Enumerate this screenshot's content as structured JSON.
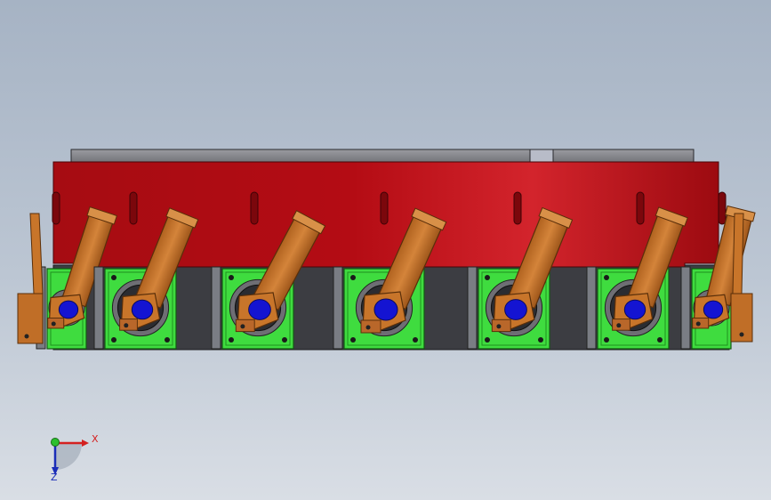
{
  "viewport": {
    "background_top": "#a6b3c4",
    "background_bottom": "#d9dee5"
  },
  "colors": {
    "ring_red": "#c81018",
    "ring_dark": "#8a0a10",
    "top_plate": "#8c8c90",
    "mount_green": "#3fdc3f",
    "bracket_grey": "#7a7d84",
    "lever_orange": "#c8752a",
    "pin_blue": "#1414d2"
  },
  "assembly": {
    "station_count": 7
  },
  "triad": {
    "x_label": "X",
    "z_label": "Z",
    "icon": "coordinate-triad-icon"
  }
}
